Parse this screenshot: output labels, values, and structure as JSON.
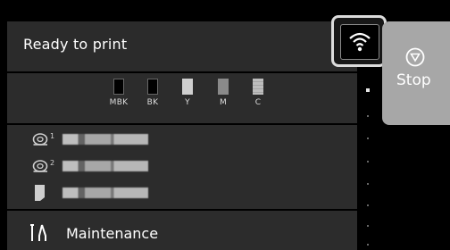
{
  "status": {
    "text": "Ready to print"
  },
  "wifi": {
    "icon": "wifi-icon"
  },
  "stop_button": {
    "label": "Stop",
    "icon": "stop-icon"
  },
  "inks": [
    {
      "label": "MBK",
      "color": "#000000",
      "level_fraction": 0
    },
    {
      "label": "BK",
      "color": "#000000",
      "level_fraction": 0
    },
    {
      "label": "Y",
      "color": "#cfcfcf",
      "level_fraction": 1
    },
    {
      "label": "M",
      "color": "#8a8a8a",
      "level_fraction": 1
    },
    {
      "label": "C",
      "color": "#bfbfbf",
      "level_fraction": 1
    }
  ],
  "media": [
    {
      "icon": "roll1-icon",
      "badge": "1"
    },
    {
      "icon": "roll2-icon",
      "badge": "2"
    },
    {
      "icon": "sheet-icon"
    }
  ],
  "maintenance": {
    "label": "Maintenance",
    "icon": "maintenance-icon"
  },
  "page_indicator": {
    "pages": 8,
    "current": 1
  }
}
